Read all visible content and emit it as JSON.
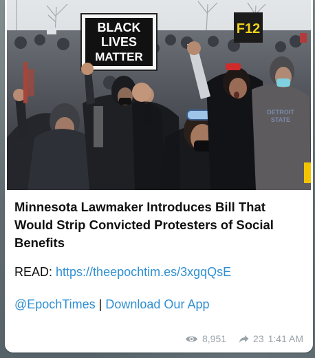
{
  "post": {
    "headline": "Minnesota Lawmaker Introduces Bill That Would Strip Convicted Protesters of Social Benefits",
    "read_label": "READ:",
    "read_link": "https://theepochtim.es/3xgqQsE",
    "mention": "@EpochTimes",
    "separator": "|",
    "download_link": "Download Our App",
    "views": "8,951",
    "forwards": "23",
    "time": "1:41 AM"
  },
  "photo": {
    "sign_text_line1": "BLACK",
    "sign_text_line2": "LIVES",
    "sign_text_line3": "MATTER",
    "sign2_text": "F12",
    "sweatshirt_text_line1": "DETROIT",
    "sweatshirt_text_line2": "STATE"
  },
  "colors": {
    "link": "#2f8fd1",
    "meta": "#9aa3a8",
    "headline": "#111111"
  },
  "icons": {
    "views": "eye-icon",
    "forwards": "forward-arrow-icon"
  }
}
